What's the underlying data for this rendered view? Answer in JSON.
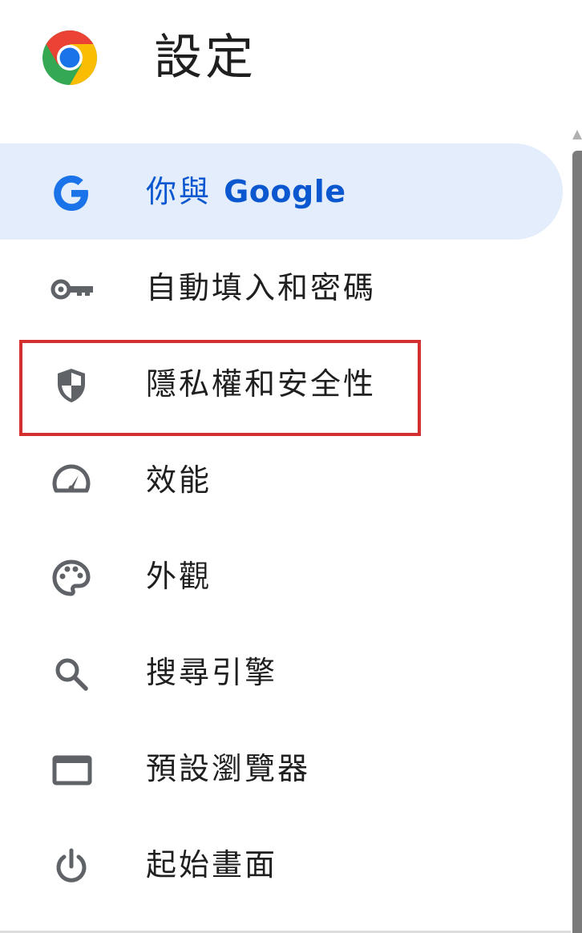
{
  "header": {
    "title": "設定",
    "logo": "chrome-logo"
  },
  "sidebar": {
    "items": [
      {
        "icon": "google-g-icon",
        "label_prefix": "你與 ",
        "label_brand": "Google",
        "active": true
      },
      {
        "icon": "key-icon",
        "label": "自動填入和密碼"
      },
      {
        "icon": "shield-icon",
        "label": "隱私權和安全性",
        "highlighted": true
      },
      {
        "icon": "speedometer-icon",
        "label": "效能"
      },
      {
        "icon": "palette-icon",
        "label": "外觀"
      },
      {
        "icon": "search-icon",
        "label": "搜尋引擎"
      },
      {
        "icon": "browser-window-icon",
        "label": "預設瀏覽器"
      },
      {
        "icon": "power-icon",
        "label": "起始畫面"
      }
    ]
  },
  "colors": {
    "active_bg": "#e3edfb",
    "active_text": "#0b57d0",
    "highlight_border": "#d32f2f",
    "icon_gray": "#5f6368"
  }
}
